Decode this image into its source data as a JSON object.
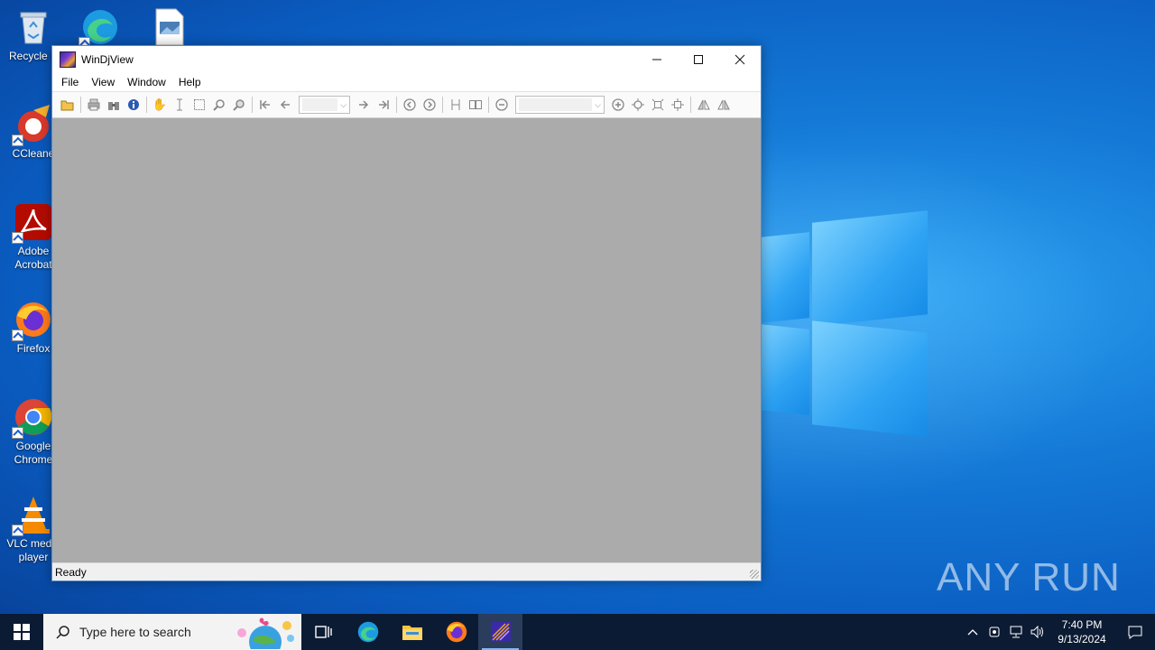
{
  "desktop": {
    "icons": [
      {
        "label": "Recycle B",
        "icon": "recycle-bin-icon"
      },
      {
        "label": "",
        "icon": "edge-icon"
      },
      {
        "label": "",
        "icon": "image-file-icon"
      },
      {
        "label": "CCleane",
        "icon": "ccleaner-icon"
      },
      {
        "label": "Adobe Acrobat",
        "icon": "acrobat-icon"
      },
      {
        "label": "Firefox",
        "icon": "firefox-icon"
      },
      {
        "label": "Google Chrome",
        "icon": "chrome-icon"
      },
      {
        "label": "VLC media player",
        "icon": "vlc-icon"
      }
    ],
    "watermark": {
      "left": "ANY",
      "right": "RUN"
    }
  },
  "window": {
    "title": "WinDjView",
    "controls": {
      "minimize": "—",
      "maximize": "☐",
      "close": "✕"
    },
    "menu": [
      "File",
      "View",
      "Window",
      "Help"
    ],
    "status": "Ready",
    "toolbar_icons": [
      "open-icon",
      "print-icon",
      "find-icon",
      "info-icon",
      "hand-icon",
      "text-select-icon",
      "rect-select-icon",
      "zoom-icon",
      "magnify-icon",
      "first-page-icon",
      "prev-page-icon",
      "page-combo",
      "next-page-icon",
      "last-page-icon",
      "back-icon",
      "forward-icon",
      "single-page-icon",
      "two-page-icon",
      "zoom-out-icon",
      "zoom-combo",
      "zoom-in-icon",
      "fit-page-icon",
      "fit-width-icon",
      "actual-size-icon",
      "rotate-left-icon",
      "rotate-right-icon"
    ]
  },
  "taskbar": {
    "search_placeholder": "Type here to search",
    "apps": [
      "task-view-icon",
      "edge-icon",
      "file-explorer-icon",
      "firefox-icon",
      "windjview-icon"
    ],
    "active_app": "windjview-icon",
    "clock": {
      "time": "7:40 PM",
      "date": "9/13/2024"
    }
  }
}
